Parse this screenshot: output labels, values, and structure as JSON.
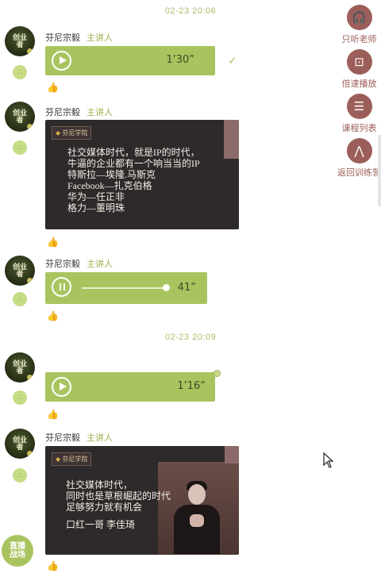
{
  "timestamps": [
    "02-23 20:06",
    "02-23 20:09"
  ],
  "speaker": {
    "name": "芬尼宗毅",
    "role": "主讲人"
  },
  "messages": [
    {
      "type": "voice",
      "duration": "1’30”"
    },
    {
      "type": "image",
      "badge": "芬尼学院",
      "lines": [
        "社交媒体时代，就是IP的时代，",
        "牛逼的企业都有一个响当当的IP",
        "特斯拉—埃隆.马斯克",
        "Facebook—扎克伯格",
        "华为—任正非",
        "格力—董明珠"
      ]
    },
    {
      "type": "voice",
      "duration": "41”",
      "playing": true
    },
    {
      "type": "voice",
      "duration": "1’16”"
    },
    {
      "type": "image",
      "badge": "芬尼学院",
      "lines": [
        "社交媒体时代，",
        "同时也是草根崛起的时代",
        "足够努力就有机会",
        "",
        "口红一哥  李佳琦"
      ]
    }
  ],
  "right_menu": [
    {
      "label": "只听老师",
      "icon": "headphones-icon",
      "glyph": "🎧"
    },
    {
      "label": "倍速播放",
      "icon": "speed-icon",
      "glyph": "⊡"
    },
    {
      "label": "课程列表",
      "icon": "list-icon",
      "glyph": "☰"
    },
    {
      "label": "返回训练营",
      "icon": "camp-icon",
      "glyph": "⋀"
    }
  ],
  "broadcast_button": "直播\n战场",
  "avatar_text": "创业\n者",
  "colors": {
    "accent": "#a9c45f",
    "menu": "#9c5e5a",
    "card": "#2e2a2b"
  }
}
